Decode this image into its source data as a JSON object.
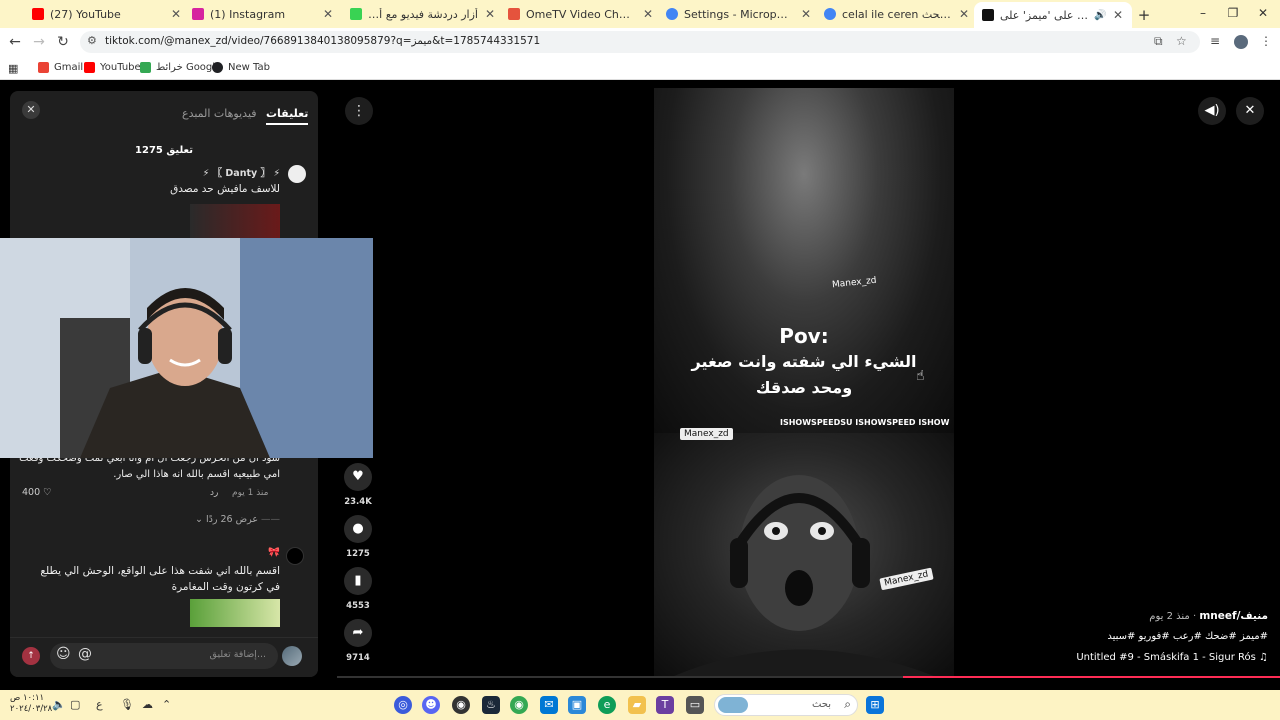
{
  "tabs": [
    {
      "title": "(27) YouTube",
      "favicon_color": "#ff0000"
    },
    {
      "title": "(1) Instagram",
      "favicon_color": "#d6249f"
    },
    {
      "title": "أزار دردشة فيديو مع أشخاص جدد",
      "favicon_color": "#39d353"
    },
    {
      "title": "OmeTV Video Chat — Omegle",
      "favicon_color": "#e5533d"
    },
    {
      "title": "Settings - Microphone",
      "favicon_color": "#4285f4"
    },
    {
      "title": "celal ile ceren مترجم - بحث Goo",
      "favicon_color": "#4285f4"
    },
    {
      "title": "اعثر على 'ميمز' على TikTok",
      "favicon_color": "#111111"
    }
  ],
  "address": {
    "url": "tiktok.com/@manex_zd/video/7668913840138095879?q=ميمز&t=1785744331571"
  },
  "bookmarks": [
    {
      "label": "Gmail",
      "color": "#ea4335"
    },
    {
      "label": "YouTube",
      "color": "#ff0000"
    },
    {
      "label": "خرائط Google",
      "color": "#34a853"
    },
    {
      "label": "New Tab",
      "color": "#202124"
    }
  ],
  "comments_panel": {
    "tab_comments": "تعليقات",
    "tab_creator_videos": "فيديوهات المبدع",
    "count_label": "1275 تعليق",
    "comment1": {
      "user": "⚡ 〖 Danty 〗 ⚡",
      "text": "للاسف مافيش حد مصدق"
    },
    "comment2": {
      "text_line1": "سود ان من الحرس رجعت ال ام وانا ابغي لمت وضحكت وقعت",
      "text_line2": "امي طبيعيه اقسم بالله انه هاذا الي صار.",
      "likes": "400",
      "time": "منذ 1 يوم",
      "reply": "رد",
      "view_replies": "عرض 26 ردًا"
    },
    "comment3": {
      "text": "اقسم بالله اني شفت هذا على الواقع، الوحش الي يطلع في كرتون وقت المغامرة"
    },
    "input_placeholder": "إضافة تعليق..."
  },
  "actions": {
    "likes": "23.4K",
    "comments": "1275",
    "saves": "4553",
    "shares": "9714"
  },
  "video": {
    "pov": "Pov:",
    "caption_line1": "الشيء الي شفته وانت صغير",
    "caption_line2": "ومحد صدقك",
    "watermark": "Manex_zd",
    "ishow_text": "ISHOWSPEEDSU ISHOWSPEED ISHOW"
  },
  "video_info": {
    "author": "منيف/mneef",
    "time": "منذ 2 يوم",
    "hashtags": "#ميمز #ضحك #رعب #فوريو #سبيد",
    "music": "Untitled #9 - Smáskifa 1 - Sigur Rós ♫"
  },
  "progress": {
    "fraction": 0.4
  },
  "taskbar": {
    "search": "بحث",
    "time": "١٠:١١ ص",
    "date": "٢٠٢٤/٠٣/٢٨",
    "lang": "ع"
  }
}
